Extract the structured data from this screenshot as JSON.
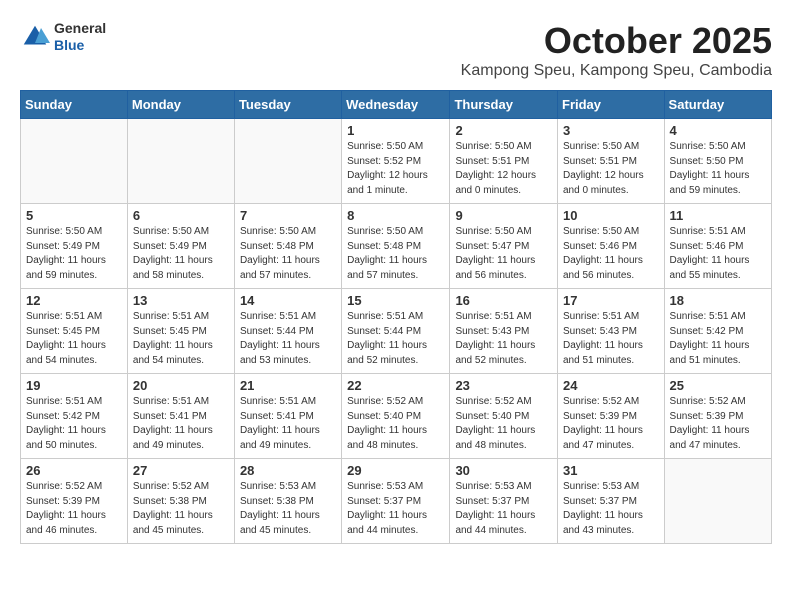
{
  "logo": {
    "general": "General",
    "blue": "Blue"
  },
  "title": "October 2025",
  "location": "Kampong Speu, Kampong Speu, Cambodia",
  "weekdays": [
    "Sunday",
    "Monday",
    "Tuesday",
    "Wednesday",
    "Thursday",
    "Friday",
    "Saturday"
  ],
  "weeks": [
    [
      {
        "day": "",
        "info": ""
      },
      {
        "day": "",
        "info": ""
      },
      {
        "day": "",
        "info": ""
      },
      {
        "day": "1",
        "info": "Sunrise: 5:50 AM\nSunset: 5:52 PM\nDaylight: 12 hours and 1 minute."
      },
      {
        "day": "2",
        "info": "Sunrise: 5:50 AM\nSunset: 5:51 PM\nDaylight: 12 hours and 0 minutes."
      },
      {
        "day": "3",
        "info": "Sunrise: 5:50 AM\nSunset: 5:51 PM\nDaylight: 12 hours and 0 minutes."
      },
      {
        "day": "4",
        "info": "Sunrise: 5:50 AM\nSunset: 5:50 PM\nDaylight: 11 hours and 59 minutes."
      }
    ],
    [
      {
        "day": "5",
        "info": "Sunrise: 5:50 AM\nSunset: 5:49 PM\nDaylight: 11 hours and 59 minutes."
      },
      {
        "day": "6",
        "info": "Sunrise: 5:50 AM\nSunset: 5:49 PM\nDaylight: 11 hours and 58 minutes."
      },
      {
        "day": "7",
        "info": "Sunrise: 5:50 AM\nSunset: 5:48 PM\nDaylight: 11 hours and 57 minutes."
      },
      {
        "day": "8",
        "info": "Sunrise: 5:50 AM\nSunset: 5:48 PM\nDaylight: 11 hours and 57 minutes."
      },
      {
        "day": "9",
        "info": "Sunrise: 5:50 AM\nSunset: 5:47 PM\nDaylight: 11 hours and 56 minutes."
      },
      {
        "day": "10",
        "info": "Sunrise: 5:50 AM\nSunset: 5:46 PM\nDaylight: 11 hours and 56 minutes."
      },
      {
        "day": "11",
        "info": "Sunrise: 5:51 AM\nSunset: 5:46 PM\nDaylight: 11 hours and 55 minutes."
      }
    ],
    [
      {
        "day": "12",
        "info": "Sunrise: 5:51 AM\nSunset: 5:45 PM\nDaylight: 11 hours and 54 minutes."
      },
      {
        "day": "13",
        "info": "Sunrise: 5:51 AM\nSunset: 5:45 PM\nDaylight: 11 hours and 54 minutes."
      },
      {
        "day": "14",
        "info": "Sunrise: 5:51 AM\nSunset: 5:44 PM\nDaylight: 11 hours and 53 minutes."
      },
      {
        "day": "15",
        "info": "Sunrise: 5:51 AM\nSunset: 5:44 PM\nDaylight: 11 hours and 52 minutes."
      },
      {
        "day": "16",
        "info": "Sunrise: 5:51 AM\nSunset: 5:43 PM\nDaylight: 11 hours and 52 minutes."
      },
      {
        "day": "17",
        "info": "Sunrise: 5:51 AM\nSunset: 5:43 PM\nDaylight: 11 hours and 51 minutes."
      },
      {
        "day": "18",
        "info": "Sunrise: 5:51 AM\nSunset: 5:42 PM\nDaylight: 11 hours and 51 minutes."
      }
    ],
    [
      {
        "day": "19",
        "info": "Sunrise: 5:51 AM\nSunset: 5:42 PM\nDaylight: 11 hours and 50 minutes."
      },
      {
        "day": "20",
        "info": "Sunrise: 5:51 AM\nSunset: 5:41 PM\nDaylight: 11 hours and 49 minutes."
      },
      {
        "day": "21",
        "info": "Sunrise: 5:51 AM\nSunset: 5:41 PM\nDaylight: 11 hours and 49 minutes."
      },
      {
        "day": "22",
        "info": "Sunrise: 5:52 AM\nSunset: 5:40 PM\nDaylight: 11 hours and 48 minutes."
      },
      {
        "day": "23",
        "info": "Sunrise: 5:52 AM\nSunset: 5:40 PM\nDaylight: 11 hours and 48 minutes."
      },
      {
        "day": "24",
        "info": "Sunrise: 5:52 AM\nSunset: 5:39 PM\nDaylight: 11 hours and 47 minutes."
      },
      {
        "day": "25",
        "info": "Sunrise: 5:52 AM\nSunset: 5:39 PM\nDaylight: 11 hours and 47 minutes."
      }
    ],
    [
      {
        "day": "26",
        "info": "Sunrise: 5:52 AM\nSunset: 5:39 PM\nDaylight: 11 hours and 46 minutes."
      },
      {
        "day": "27",
        "info": "Sunrise: 5:52 AM\nSunset: 5:38 PM\nDaylight: 11 hours and 45 minutes."
      },
      {
        "day": "28",
        "info": "Sunrise: 5:53 AM\nSunset: 5:38 PM\nDaylight: 11 hours and 45 minutes."
      },
      {
        "day": "29",
        "info": "Sunrise: 5:53 AM\nSunset: 5:37 PM\nDaylight: 11 hours and 44 minutes."
      },
      {
        "day": "30",
        "info": "Sunrise: 5:53 AM\nSunset: 5:37 PM\nDaylight: 11 hours and 44 minutes."
      },
      {
        "day": "31",
        "info": "Sunrise: 5:53 AM\nSunset: 5:37 PM\nDaylight: 11 hours and 43 minutes."
      },
      {
        "day": "",
        "info": ""
      }
    ]
  ]
}
